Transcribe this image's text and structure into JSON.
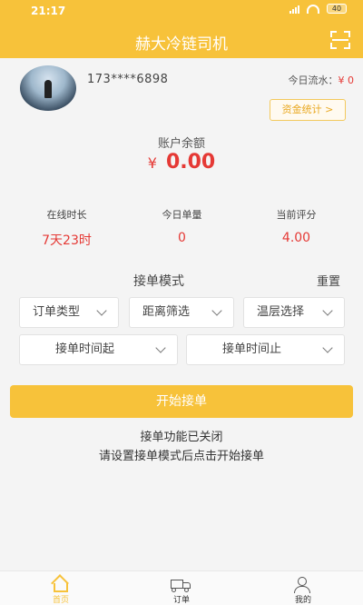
{
  "status_bar": {
    "time": "21:17",
    "battery": "40"
  },
  "header": {
    "title": "赫大冷链司机"
  },
  "profile": {
    "phone": "173****6898",
    "today_flow_label": "今日流水：",
    "today_flow_amount": "¥ 0",
    "fund_stats_label": "资金统计 >"
  },
  "balance": {
    "label": "账户余额",
    "currency": "¥",
    "amount": "0.00"
  },
  "stats": [
    {
      "label": "在线时长",
      "value": "7天23时"
    },
    {
      "label": "今日单量",
      "value": "0"
    },
    {
      "label": "当前评分",
      "value": "4.00"
    }
  ],
  "mode": {
    "label": "接单模式",
    "reset_label": "重置",
    "filters": [
      "订单类型",
      "距离筛选",
      "温层选择",
      "接单时间起",
      "接单时间止"
    ]
  },
  "actions": {
    "start_label": "开始接单",
    "status_text": "接单功能已关闭",
    "hint_text": "请设置接单模式后点击开始接单"
  },
  "tabbar": {
    "items": [
      "首页",
      "订单",
      "我的"
    ]
  },
  "colors": {
    "accent": "#f7c23a",
    "price": "#e53935"
  }
}
